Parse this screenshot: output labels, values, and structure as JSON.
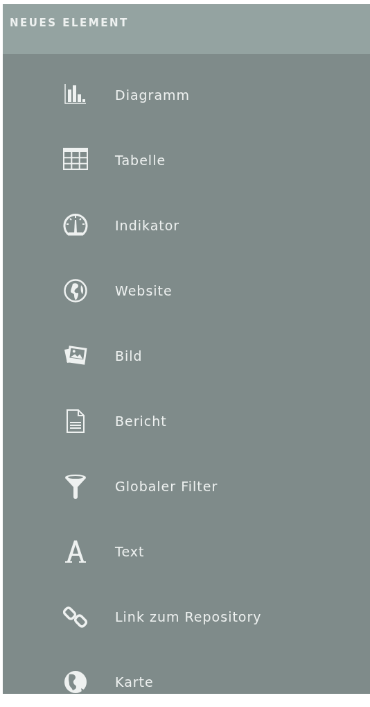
{
  "panel": {
    "title": "NEUES ELEMENT"
  },
  "items": [
    {
      "kind": "chart",
      "label": "Diagramm"
    },
    {
      "kind": "table",
      "label": "Tabelle"
    },
    {
      "kind": "gauge",
      "label": "Indikator"
    },
    {
      "kind": "globe",
      "label": "Website"
    },
    {
      "kind": "image",
      "label": "Bild"
    },
    {
      "kind": "document",
      "label": "Bericht"
    },
    {
      "kind": "filter",
      "label": "Globaler Filter"
    },
    {
      "kind": "text",
      "label": "Text"
    },
    {
      "kind": "link",
      "label": "Link zum Repository"
    },
    {
      "kind": "map",
      "label": "Karte"
    }
  ]
}
